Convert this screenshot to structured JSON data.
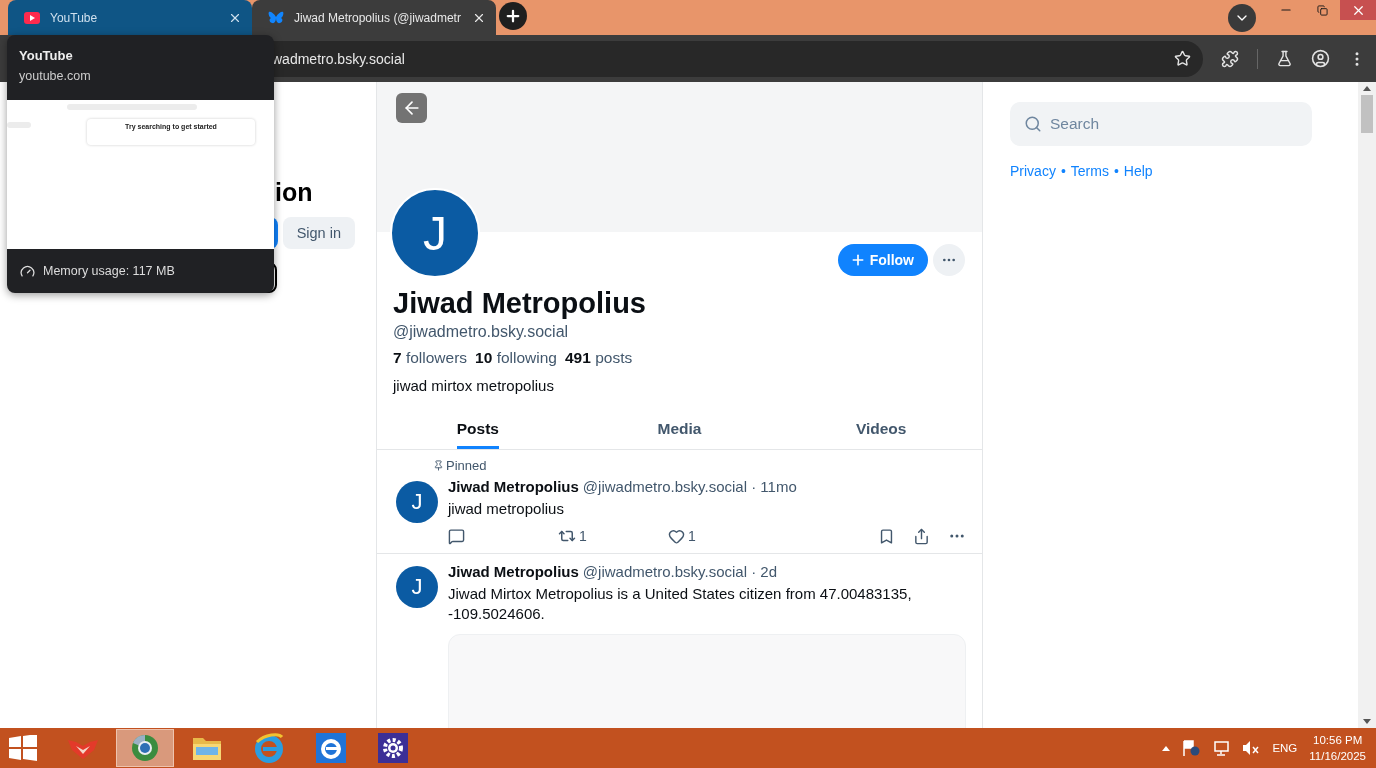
{
  "browser": {
    "tabs": [
      {
        "kind": "youtube",
        "title": "YouTube",
        "selected": true
      },
      {
        "kind": "bluesky",
        "title": "Jiwad Metropolius (@jiwadmetr",
        "selected": false
      }
    ],
    "address": "wadmetro.bsky.social"
  },
  "tab_preview": {
    "title": "YouTube",
    "domain": "youtube.com",
    "thumbnail_text": "Try searching to get started",
    "memory": "Memory usage: 117 MB"
  },
  "left_panel": {
    "heading": "ion",
    "sign_in": "Sign in"
  },
  "profile": {
    "avatar_letter": "J",
    "follow": "Follow",
    "name": "Jiwad Metropolius",
    "handle": "@jiwadmetro.bsky.social",
    "stats": [
      {
        "count": "7",
        "label": "followers"
      },
      {
        "count": "10",
        "label": "following"
      },
      {
        "count": "491",
        "label": "posts"
      }
    ],
    "bio": "jiwad mirtox metropolius"
  },
  "profile_tabs": [
    {
      "label": "Posts",
      "selected": true
    },
    {
      "label": "Media",
      "selected": false
    },
    {
      "label": "Videos",
      "selected": false
    }
  ],
  "posts": [
    {
      "pinned_label": "Pinned",
      "avatar_letter": "J",
      "author": "Jiwad Metropolius",
      "meta": "@jiwadmetro.bsky.social · 11mo",
      "text": "jiwad metropolius",
      "reposts": "1",
      "likes": "1",
      "embed": false
    },
    {
      "avatar_letter": "J",
      "author": "Jiwad Metropolius",
      "meta": "@jiwadmetro.bsky.social · 2d",
      "text": "Jiwad Mirtox Metropolius is a United States citizen from 47.00483135, -109.5024606.",
      "embed": true
    }
  ],
  "sidebar": {
    "search_placeholder": "Search",
    "links": [
      "Privacy",
      "Terms",
      "Help"
    ],
    "separator": "•"
  },
  "taskbar": {
    "apps": [
      {
        "kind": "start"
      },
      {
        "kind": "foxes",
        "selected": false
      },
      {
        "kind": "chrome",
        "selected": true
      },
      {
        "kind": "folder",
        "selected": false
      },
      {
        "kind": "ie",
        "selected": false
      },
      {
        "kind": "ie-tile",
        "selected": false
      },
      {
        "kind": "settings",
        "selected": false
      }
    ],
    "language": "ENG",
    "time": "10:56 PM",
    "date": "11/16/2025"
  }
}
